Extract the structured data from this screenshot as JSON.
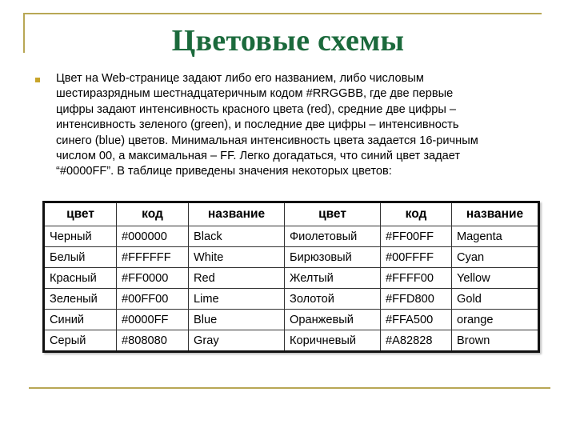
{
  "slide": {
    "title": "Цветовые схемы",
    "paragraph_lines": [
      "Цвет на Web-странице задают либо его названием, либо числовым",
      "шестиразрядным шестнадцатеричным кодом #RRGGBB, где две первые",
      "цифры задают интенсивность красного цвета (red), средние две цифры –",
      "интенсивность зеленого (green), и последние две цифры – интенсивность",
      "синего (blue) цветов. Минимальная интенсивность цвета задается 16-ричным",
      "числом 00, а максимальная – FF. Легко догадаться, что синий цвет задает",
      "“#0000FF”. В таблице приведены значения некоторых цветов:"
    ],
    "colors": {
      "title": "#1b6a3c",
      "accent_rule": "#b8a755",
      "bullet": "#c8a42a"
    }
  },
  "table": {
    "headers": [
      "цвет",
      "код",
      "название",
      "цвет",
      "код",
      "название"
    ],
    "rows": [
      [
        "Черный",
        "#000000",
        "Black",
        "Фиолетовый",
        "#FF00FF",
        "Magenta"
      ],
      [
        "Белый",
        "#FFFFFF",
        "White",
        "Бирюзовый",
        "#00FFFF",
        "Cyan"
      ],
      [
        "Красный",
        "#FF0000",
        "Red",
        "Желтый",
        "#FFFF00",
        "Yellow"
      ],
      [
        "Зеленый",
        "#00FF00",
        "Lime",
        "Золотой",
        "#FFD800",
        "Gold"
      ],
      [
        "Синий",
        "#0000FF",
        "Blue",
        "Оранжевый",
        "#FFA500",
        "orange"
      ],
      [
        "Серый",
        "#808080",
        "Gray",
        "Коричневый",
        "#A82828",
        "Brown"
      ]
    ]
  }
}
